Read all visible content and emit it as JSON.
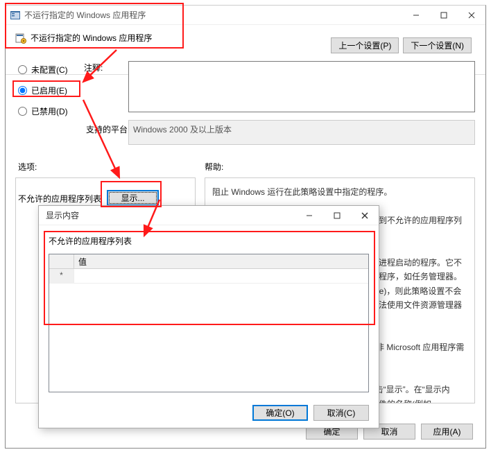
{
  "window": {
    "title": "不运行指定的 Windows 应用程序",
    "setting_title": "不运行指定的 Windows 应用程序",
    "prev_setting": "上一个设置(P)",
    "next_setting": "下一个设置(N)",
    "radio_not_configured": "未配置(C)",
    "radio_enabled": "已启用(E)",
    "radio_disabled": "已禁用(D)",
    "comment_label": "注释:",
    "comment_text": "",
    "platform_label": "支持的平台:",
    "platform_text": "Windows 2000 及以上版本",
    "options_label": "选项:",
    "help_label": "帮助:",
    "list_label": "不允许的应用程序列表",
    "show_button": "显示...",
    "help_p1": "阻止 Windows 运行在此策略设置中指定的程序。",
    "help_p2": "如果启用此策略设置，则用户无法运行已添加到不允许的应用程序列表中的程序。",
    "help_p3": "此策略设置仅阻止用户运行由文件资源管理器进程启动的程序。它不会阻止用户运行由系统进程或其他进程启动的程序，如任务管理器。 此外，如果用户可以访问命令提示符 (Cmd.exe)，则此策略设置不会阻止他们在命令窗口中启动程序，即使他们无法使用文件资源管理器启动程序。",
    "help_p4": "注意: 具有 Windows 2000 或更高版本证书的非 Microsoft 应用程序需要遵守此策略设置。",
    "help_p5": "注意: 若要创建不允许的应用程序列表，请单击“显示”。在“显示内容”对话框的“值”列中，键入应用程序可执行文件的名称(例如，Winword.exe、Poledit.exe、Powerpnt.exe)。",
    "ok": "确定",
    "cancel": "取消",
    "apply": "应用(A)"
  },
  "dialog": {
    "title": "显示内容",
    "list_label": "不允许的应用程序列表",
    "col_value": "值",
    "row_marker": "*",
    "ok": "确定(O)",
    "cancel": "取消(C)"
  }
}
